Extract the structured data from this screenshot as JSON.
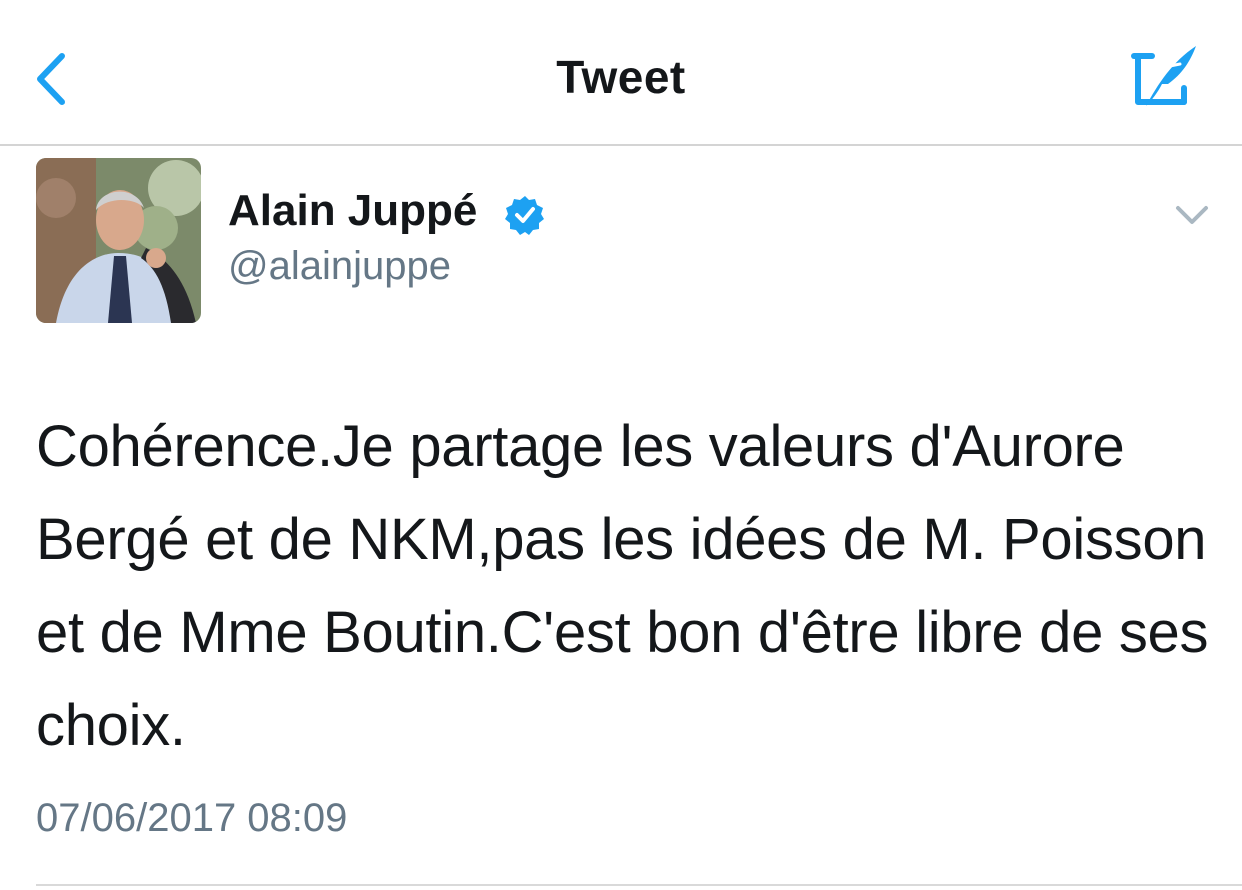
{
  "nav": {
    "title": "Tweet"
  },
  "tweet": {
    "display_name": "Alain Juppé",
    "handle": "@alainjuppe",
    "text": "Cohérence.Je partage les valeurs d'Aurore Bergé et de NKM,pas les idées de M. Poisson et de Mme Boutin.C'est bon d'être libre de ses choix.",
    "timestamp": "07/06/2017 08:09",
    "verified": true
  },
  "icons": {
    "back": "chevron-left-icon",
    "compose": "compose-icon",
    "verified": "verified-badge-icon",
    "caret": "chevron-down-icon"
  },
  "colors": {
    "accent": "#1da1f2",
    "text": "#14171a",
    "secondary": "#657786"
  }
}
